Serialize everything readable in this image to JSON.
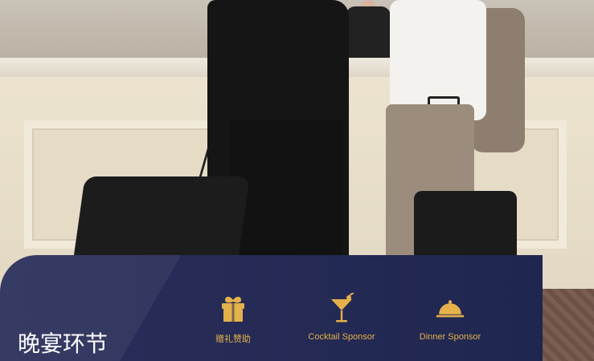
{
  "banner": {
    "title": "晚宴环节",
    "items": [
      {
        "label": "赠礼赞助",
        "icon": "gift-icon"
      },
      {
        "label": "Cocktail Sponsor",
        "icon": "cocktail-icon"
      },
      {
        "label": "Dinner Sponsor",
        "icon": "dinner-cloche-icon"
      }
    ],
    "colors": {
      "banner_bg": "#1f2650",
      "accent": "#e4b14a",
      "title_text": "#ffffff"
    }
  }
}
